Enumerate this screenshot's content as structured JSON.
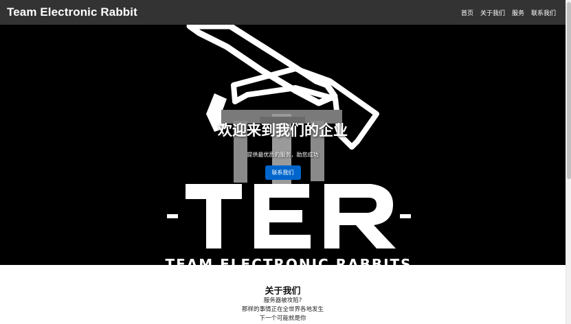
{
  "navbar": {
    "brand": "Team Electronic Rabbit",
    "links": [
      "首页",
      "关于我们",
      "服务",
      "联系我们"
    ]
  },
  "hero": {
    "title": "欢迎来到我们的企业",
    "subtitle": "提供最优质的服务，助您成功",
    "button_label": "联系我们",
    "logo_text": "TER",
    "logo_tagline": "TEAM ELECTRONIC RABBITS"
  },
  "about": {
    "title": "关于我们",
    "lines": [
      "服务器被攻陷?",
      "那样的事情正在全世界各地发生",
      "下一个可能就是你"
    ]
  },
  "colors": {
    "navbar": "#333333",
    "hero_background": "#000000",
    "accent_button": "#0066cc"
  }
}
